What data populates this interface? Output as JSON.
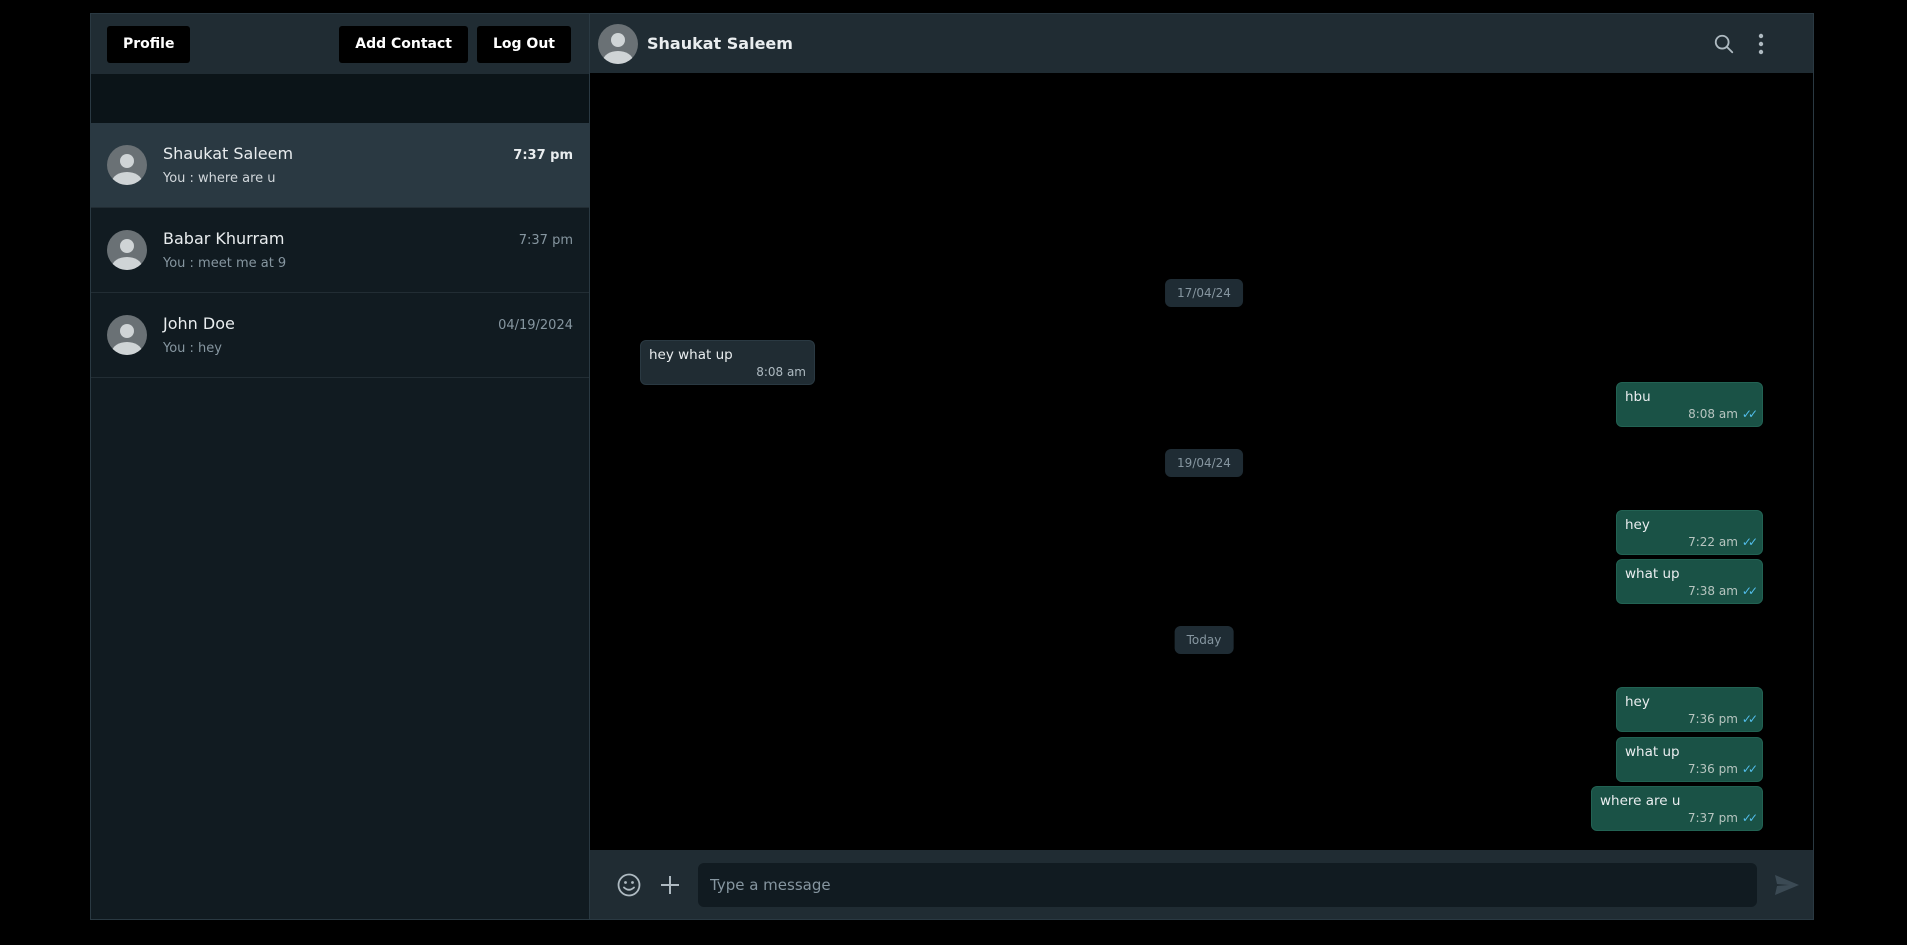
{
  "sidebar": {
    "profile_label": "Profile",
    "add_contact_label": "Add Contact",
    "logout_label": "Log Out",
    "contacts": [
      {
        "name": "Shaukat Saleem",
        "time": "7:37 pm",
        "preview": "You : where are u",
        "active": true
      },
      {
        "name": "Babar Khurram",
        "time": "7:37 pm",
        "preview": "You : meet me at 9",
        "active": false
      },
      {
        "name": "John Doe",
        "time": "04/19/2024",
        "preview": "You : hey",
        "active": false
      }
    ]
  },
  "chat": {
    "title": "Shaukat Saleem",
    "icons": [
      "search-icon",
      "more-vertical-icon"
    ],
    "dates": [
      "17/04/24",
      "19/04/24",
      "Today"
    ],
    "messages": [
      {
        "text": "hey what up",
        "time": "8:08 am",
        "direction": "in"
      },
      {
        "text": "hbu",
        "time": "8:08 am",
        "direction": "out"
      },
      {
        "text": "hey",
        "time": "7:22 am",
        "direction": "out"
      },
      {
        "text": "what up",
        "time": "7:38 am",
        "direction": "out"
      },
      {
        "text": "hey",
        "time": "7:36 pm",
        "direction": "out"
      },
      {
        "text": "what up",
        "time": "7:36 pm",
        "direction": "out"
      },
      {
        "text": "where are u",
        "time": "7:37 pm",
        "direction": "out"
      }
    ],
    "composer": {
      "placeholder": "Type a message",
      "icons": [
        "emoji-icon",
        "plus-icon",
        "send-icon"
      ]
    }
  },
  "colors": {
    "panel": "#202c33",
    "background": "#111b21",
    "outgoing_bubble": "#1a5246",
    "tick_blue": "#53bdeb"
  }
}
